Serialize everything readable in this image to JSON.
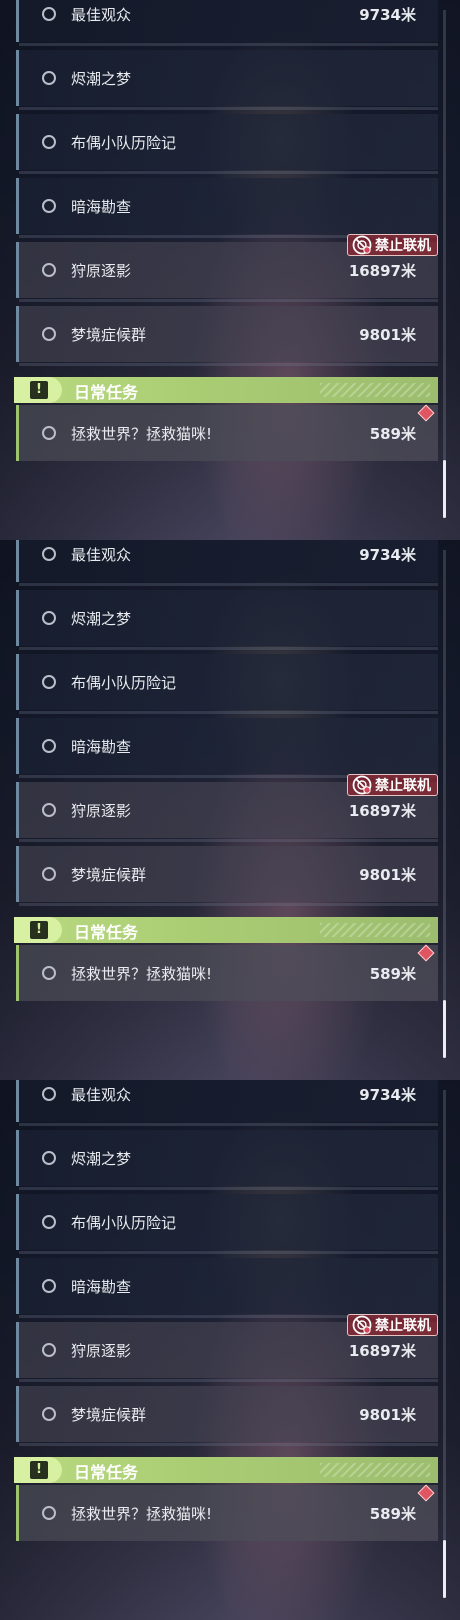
{
  "panels": [
    {
      "missions": [
        {
          "name": "最佳观众",
          "distance": "9734米"
        },
        {
          "name": "烬潮之梦",
          "distance": ""
        },
        {
          "name": "布偶小队历险记",
          "distance": ""
        },
        {
          "name": "暗海勘查",
          "distance": ""
        },
        {
          "name": "狩原逐影",
          "distance": "16897米",
          "badge": "禁止联机"
        },
        {
          "name": "梦境症候群",
          "distance": "9801米"
        }
      ],
      "daily_header": "日常任务",
      "daily_icon": "!",
      "daily_mission": {
        "name": "拯救世界？拯救猫咪!",
        "distance": "589米"
      }
    },
    {
      "missions": [
        {
          "name": "最佳观众",
          "distance": "9734米"
        },
        {
          "name": "烬潮之梦",
          "distance": ""
        },
        {
          "name": "布偶小队历险记",
          "distance": ""
        },
        {
          "name": "暗海勘查",
          "distance": ""
        },
        {
          "name": "狩原逐影",
          "distance": "16897米",
          "badge": "禁止联机"
        },
        {
          "name": "梦境症候群",
          "distance": "9801米"
        }
      ],
      "daily_header": "日常任务",
      "daily_icon": "!",
      "daily_mission": {
        "name": "拯救世界？拯救猫咪!",
        "distance": "589米"
      }
    },
    {
      "missions": [
        {
          "name": "最佳观众",
          "distance": "9734米"
        },
        {
          "name": "烬潮之梦",
          "distance": ""
        },
        {
          "name": "布偶小队历险记",
          "distance": ""
        },
        {
          "name": "暗海勘查",
          "distance": ""
        },
        {
          "name": "狩原逐影",
          "distance": "16897米",
          "badge": "禁止联机"
        },
        {
          "name": "梦境症候群",
          "distance": "9801米"
        }
      ],
      "daily_header": "日常任务",
      "daily_icon": "!",
      "daily_mission": {
        "name": "拯救世界？拯救猫咪!",
        "distance": "589米"
      }
    }
  ],
  "colors": {
    "daily_accent": "#b9d97f",
    "badge_bg": "#8c2832",
    "row_border": "#6f8aa0"
  },
  "icons": {
    "mission_marker": "circle-outline-icon",
    "daily_header": "exclamation-icon",
    "badge": "no-multiplayer-icon",
    "alert": "red-diamond-icon"
  }
}
